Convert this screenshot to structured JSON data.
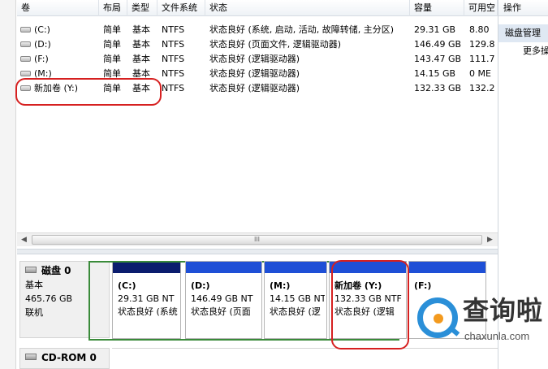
{
  "columns": [
    "卷",
    "布局",
    "类型",
    "文件系统",
    "状态",
    "容量",
    "可用空"
  ],
  "volumes": [
    {
      "name": "(C:)",
      "layout": "简单",
      "type": "基本",
      "fs": "NTFS",
      "status": "状态良好 (系统, 启动, 活动, 故障转储, 主分区)",
      "capacity": "29.31 GB",
      "free": "8.80"
    },
    {
      "name": "(D:)",
      "layout": "简单",
      "type": "基本",
      "fs": "NTFS",
      "status": "状态良好 (页面文件, 逻辑驱动器)",
      "capacity": "146.49 GB",
      "free": "129.8"
    },
    {
      "name": "(F:)",
      "layout": "简单",
      "type": "基本",
      "fs": "NTFS",
      "status": "状态良好 (逻辑驱动器)",
      "capacity": "143.47 GB",
      "free": "111.7"
    },
    {
      "name": "(M:)",
      "layout": "简单",
      "type": "基本",
      "fs": "NTFS",
      "status": "状态良好 (逻辑驱动器)",
      "capacity": "14.15 GB",
      "free": "0 ME"
    },
    {
      "name": "新加卷 (Y:)",
      "layout": "简单",
      "type": "基本",
      "fs": "NTFS",
      "status": "状态良好 (逻辑驱动器)",
      "capacity": "132.33 GB",
      "free": "132.2"
    }
  ],
  "scrollbar": {
    "left_arrow": "◀",
    "right_arrow": "▶",
    "grip": "III"
  },
  "disk": {
    "title": "磁盘 0",
    "type": "基本",
    "size": "465.76 GB",
    "state": "联机",
    "partitions": [
      {
        "name": "(C:)",
        "size": "29.31 GB NT",
        "status": "状态良好 (系统"
      },
      {
        "name": "(D:)",
        "size": "146.49 GB NT",
        "status": "状态良好 (页面"
      },
      {
        "name": "(M:)",
        "size": "14.15 GB NT",
        "status": "状态良好 (逻"
      },
      {
        "name": "新加卷  (Y:)",
        "size": "132.33 GB NTF",
        "status": "状态良好 (逻辑"
      },
      {
        "name": "(F:)",
        "size": "",
        "status": ""
      }
    ]
  },
  "cdrom": {
    "title": "CD-ROM 0"
  },
  "actions": {
    "title": "操作",
    "section": "磁盘管理",
    "more": "更多操"
  },
  "watermark": {
    "cn": "查询啦",
    "en": "chaxunla.com"
  },
  "colors": {
    "primary_bar": "#0b1d6e",
    "logical_bar": "#1e4fd6",
    "extended_border": "#3a8b3a",
    "highlight": "#d62020"
  }
}
